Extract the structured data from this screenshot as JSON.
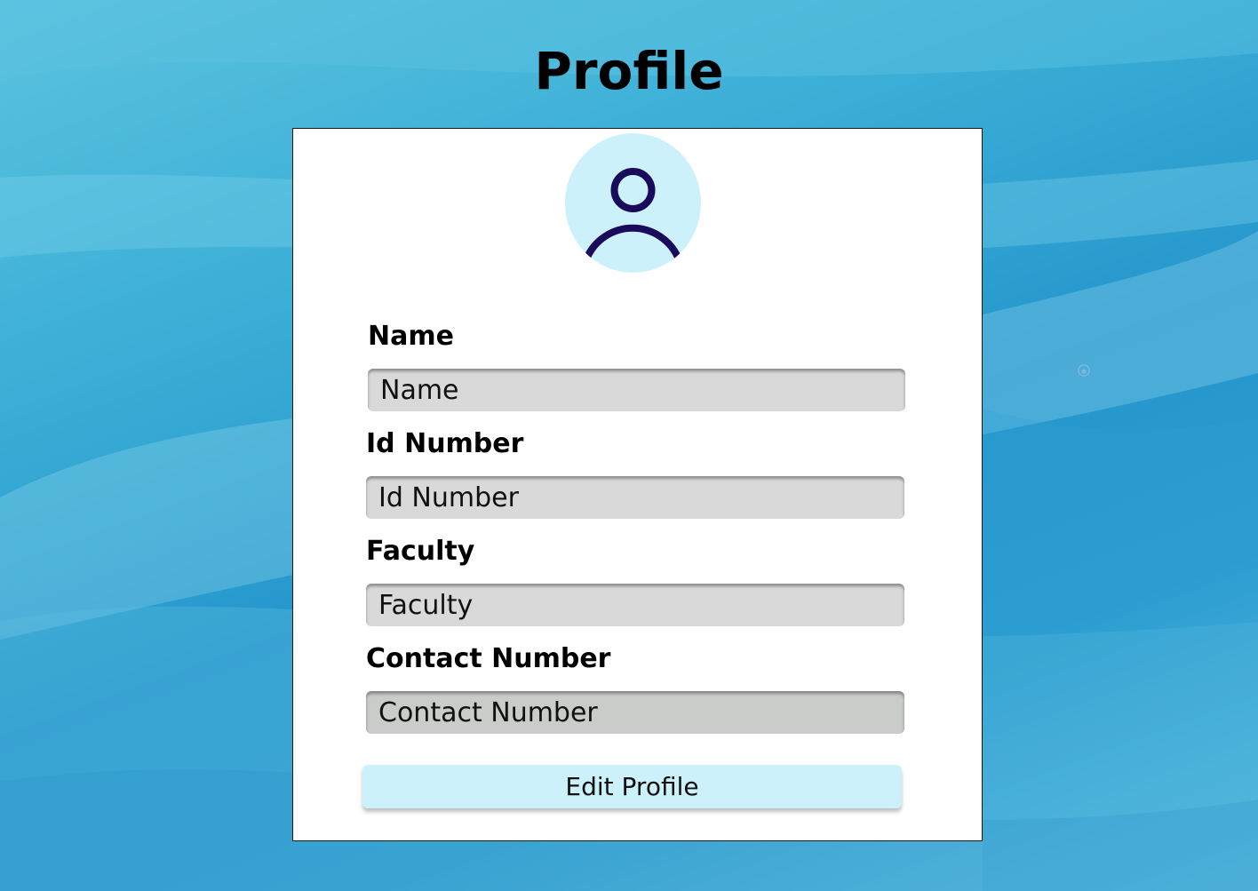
{
  "page": {
    "title": "Profile"
  },
  "profile": {
    "avatar_icon": "user-icon",
    "fields": [
      {
        "label": "Name",
        "placeholder": "Name"
      },
      {
        "label": "Id Number",
        "placeholder": "Id Number"
      },
      {
        "label": "Faculty",
        "placeholder": "Faculty"
      },
      {
        "label": "Contact Number",
        "placeholder": "Contact Number"
      }
    ],
    "edit_button_label": "Edit Profile"
  },
  "colors": {
    "avatar_bg": "#cdf1fb",
    "avatar_icon": "#1a0a5c",
    "input_bg": "#d9d9d9",
    "button_bg": "#cdf1fb"
  }
}
